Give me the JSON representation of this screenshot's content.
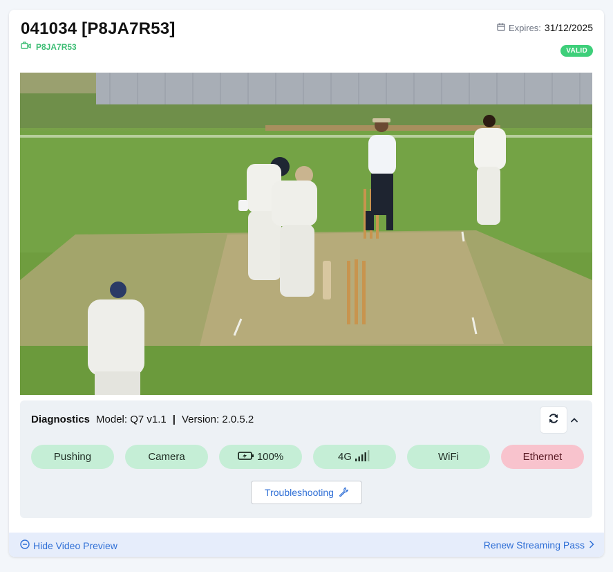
{
  "header": {
    "title": "041034 [P8JA7R53]",
    "subtitle": "P8JA7R53",
    "expires_label": "Expires:",
    "expires_value": "31/12/2025",
    "status_badge": "VALID"
  },
  "video": {
    "description_icon": "cricket-match-video-frame"
  },
  "diagnostics": {
    "heading": "Diagnostics",
    "model": "Model: Q7 v1.1",
    "separator": "|",
    "version": "Version: 2.0.5.2",
    "pills": [
      {
        "label": "Pushing",
        "status": "ok"
      },
      {
        "label": "Camera",
        "status": "ok"
      },
      {
        "label": "100%",
        "status": "ok",
        "icon": "battery-charging-icon"
      },
      {
        "label": "4G",
        "status": "ok",
        "icon": "signal-bars-icon"
      },
      {
        "label": "WiFi",
        "status": "ok"
      },
      {
        "label": "Ethernet",
        "status": "bad"
      }
    ],
    "troubleshooting_label": "Troubleshooting"
  },
  "footer": {
    "hide_preview_label": "Hide Video Preview",
    "renew_label": "Renew Streaming Pass"
  },
  "colors": {
    "accent_blue": "#2f6fd6",
    "valid_green": "#3ecf7a",
    "ok_pill": "#c5eed6",
    "bad_pill": "#f8c3cd"
  }
}
